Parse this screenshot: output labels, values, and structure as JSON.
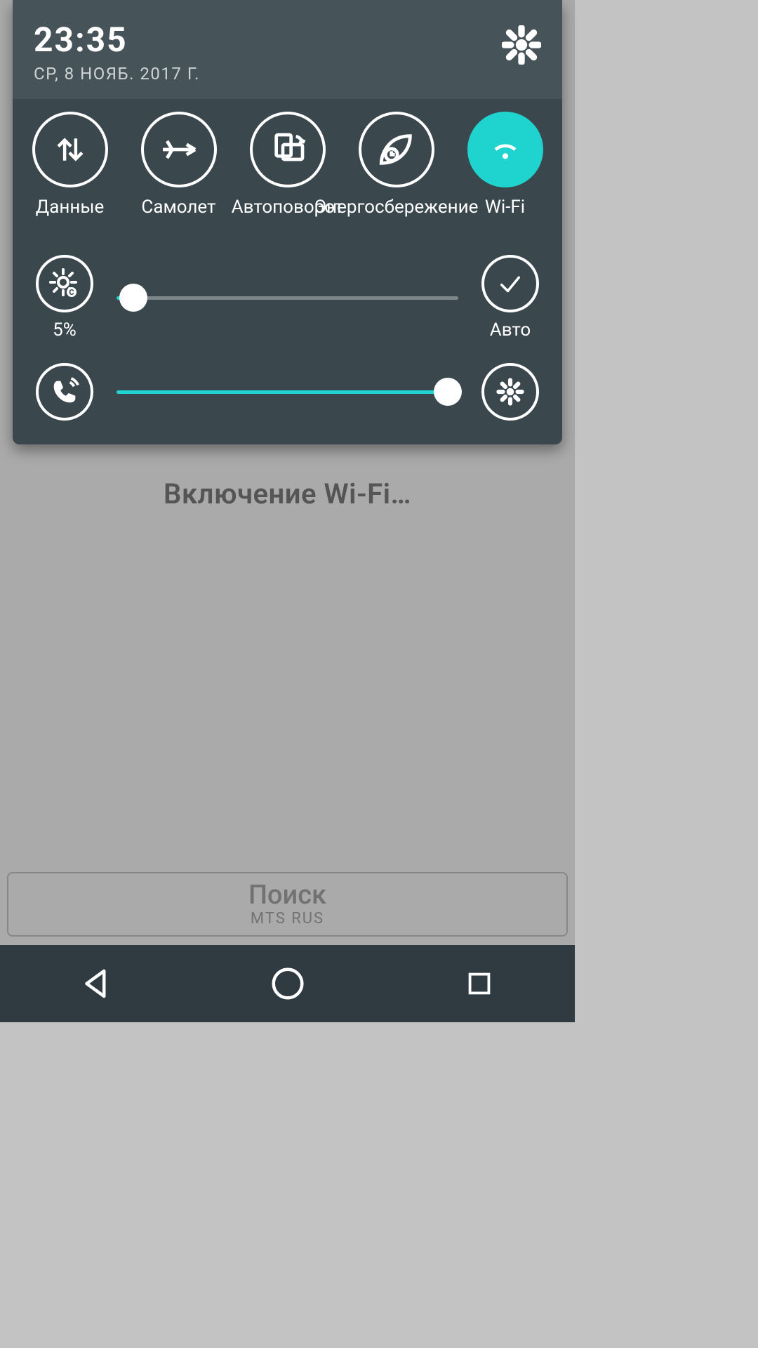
{
  "header": {
    "time": "23:35",
    "date": "СР, 8 НОЯБ. 2017 Г."
  },
  "tiles": [
    {
      "id": "data",
      "label": "Данные",
      "active": false
    },
    {
      "id": "airplane",
      "label": "Самолет",
      "active": false
    },
    {
      "id": "rotate",
      "label": "Автоповорот",
      "active": false
    },
    {
      "id": "powersave",
      "label": "Энергосбережение",
      "active": false
    },
    {
      "id": "wifi",
      "label": "Wi-Fi",
      "active": true
    }
  ],
  "brightness": {
    "percent_label": "5%",
    "value": 5,
    "auto_label": "Авто"
  },
  "volume": {
    "value": 97
  },
  "background": {
    "message": "Включение Wi-Fi…",
    "search_label": "Поиск",
    "carrier": "MTS RUS"
  },
  "colors": {
    "accent": "#1fd3cf",
    "panel": "#3a474d",
    "panel_header": "#46545a"
  }
}
